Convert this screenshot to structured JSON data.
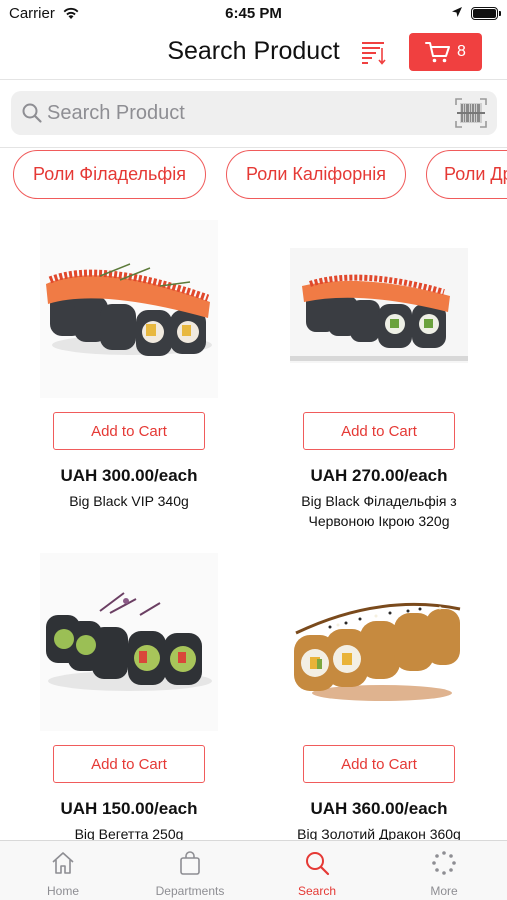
{
  "status_bar": {
    "carrier": "Carrier",
    "time": "6:45 PM"
  },
  "header": {
    "title": "Search Product",
    "cart_count": "8"
  },
  "search": {
    "placeholder": "Search Product"
  },
  "categories": [
    "Роли Філадельфія",
    "Роли Каліфорнія",
    "Роли Др"
  ],
  "products": [
    {
      "price": "UAH 300.00/each",
      "name": "Big Black VIP 340g",
      "add_label": "Add to Cart"
    },
    {
      "price": "UAH 270.00/each",
      "name": "Big Black Філадельфія з Червоною Ікрою 320g",
      "add_label": "Add to Cart"
    },
    {
      "price": "UAH 150.00/each",
      "name": "Big Вегетта 250g",
      "add_label": "Add to Cart"
    },
    {
      "price": "UAH 360.00/each",
      "name": "Big Золотий Дракон 360g",
      "add_label": "Add to Cart"
    }
  ],
  "tabbar": {
    "items": [
      {
        "label": "Home",
        "icon": "home-icon",
        "active": false
      },
      {
        "label": "Departments",
        "icon": "bag-icon",
        "active": false
      },
      {
        "label": "Search",
        "icon": "search-icon",
        "active": true
      },
      {
        "label": "More",
        "icon": "more-icon",
        "active": false
      }
    ]
  },
  "colors": {
    "accent": "#f04040",
    "text": "#111111",
    "inactive": "#8e8e93"
  }
}
